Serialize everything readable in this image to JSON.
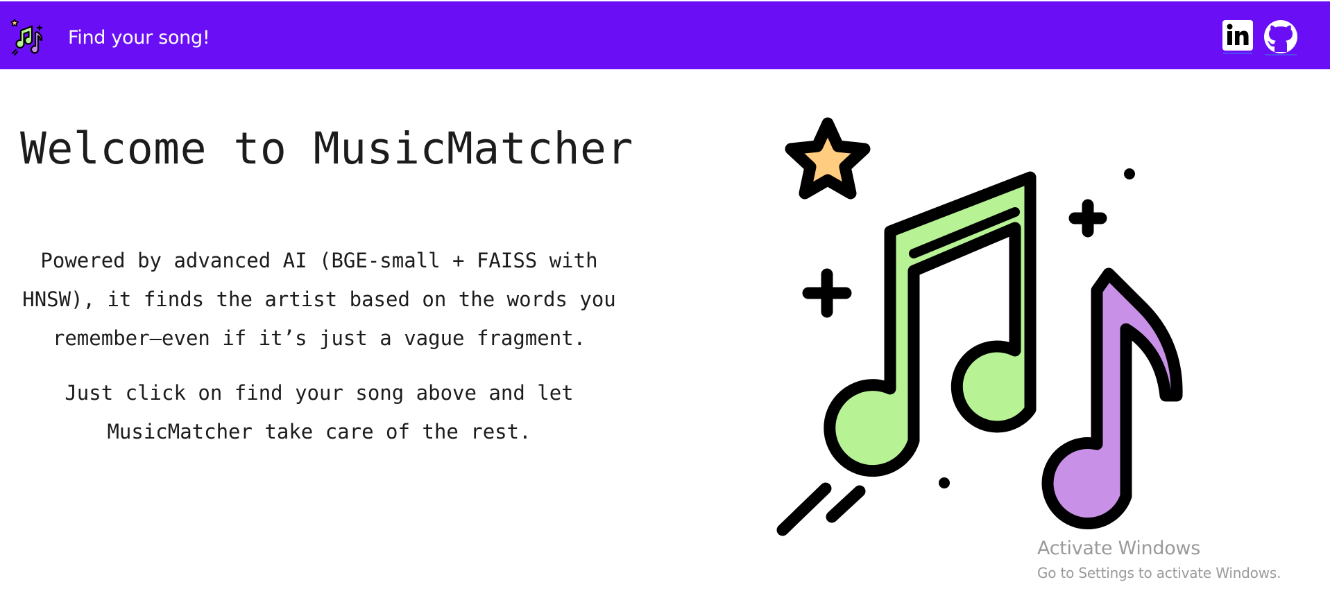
{
  "navbar": {
    "brand_label": "Find your song!",
    "brand_icon": "music-notes-icon",
    "background_color": "#6a0ff5",
    "social_links": [
      {
        "icon": "linkedin-icon"
      },
      {
        "icon": "github-icon"
      }
    ]
  },
  "hero": {
    "title": "Welcome to MusicMatcher",
    "paragraphs": [
      "Powered by advanced AI (BGE-small + FAISS with HNSW), it finds the artist based on the words you remember—even if it’s just a vague fragment.",
      "Just click on find your song above and let MusicMatcher take care of the rest."
    ],
    "illustration_icon": "music-notes-illustration",
    "colors": {
      "note_green": "#b7f295",
      "note_purple": "#c891e7",
      "star": "#ffcc80"
    }
  },
  "watermark": {
    "title": "Activate Windows",
    "subtitle": "Go to Settings to activate Windows."
  }
}
